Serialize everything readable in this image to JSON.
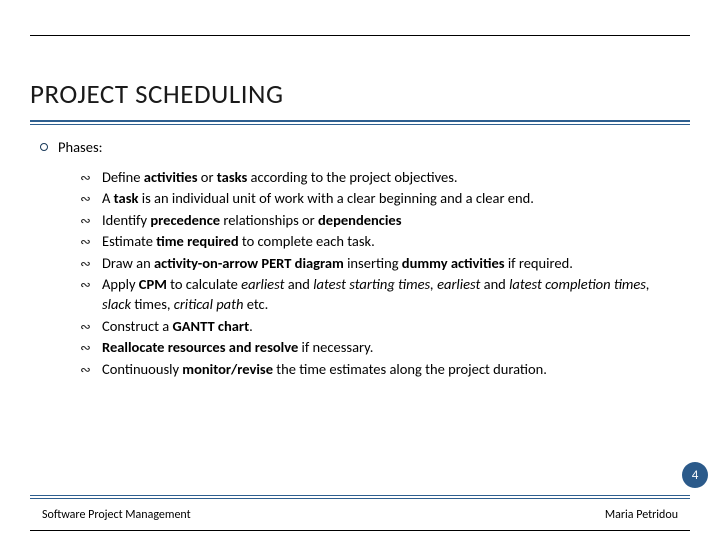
{
  "title": "PROJECT SCHEDULING",
  "main_bullet": "Phases:",
  "items": [
    {
      "pre": "Define ",
      "b1": "activities",
      "mid1": " or ",
      "b2": "tasks",
      "post": " according to the project objectives."
    },
    {
      "pre": "A ",
      "b1": "task",
      "post": " is an individual unit of work with a clear beginning and a clear end."
    },
    {
      "pre": "Identify ",
      "b1": "precedence",
      "mid1": " relationships or ",
      "b2": "dependencies",
      "post": ""
    },
    {
      "pre": "Estimate ",
      "b1": "time required",
      "post": " to complete each task."
    },
    {
      "pre": "Draw an ",
      "b1": "activity-on-arrow PERT diagram",
      "mid1": " inserting ",
      "b2": "dummy activities",
      "post": " if required."
    },
    {
      "pre": "Apply ",
      "b1": "CPM",
      "mid1": " to calculate ",
      "i_parts": [
        "earliest",
        " and ",
        "latest starting times, earliest",
        " and ",
        "latest completion times, slack",
        " times, ",
        "critical path"
      ],
      "post": " etc."
    },
    {
      "pre": "Construct a ",
      "b1": "GANTT chart",
      "post": "."
    },
    {
      "pre": "",
      "b1": "Reallocate resources and resolve",
      "post": " if necessary."
    },
    {
      "pre": "Continuously ",
      "b1": "monitor/revise",
      "post": " the time estimates along the project duration."
    }
  ],
  "footer_left": "Software Project Management",
  "footer_right": "Maria Petridou",
  "page_number": "4"
}
